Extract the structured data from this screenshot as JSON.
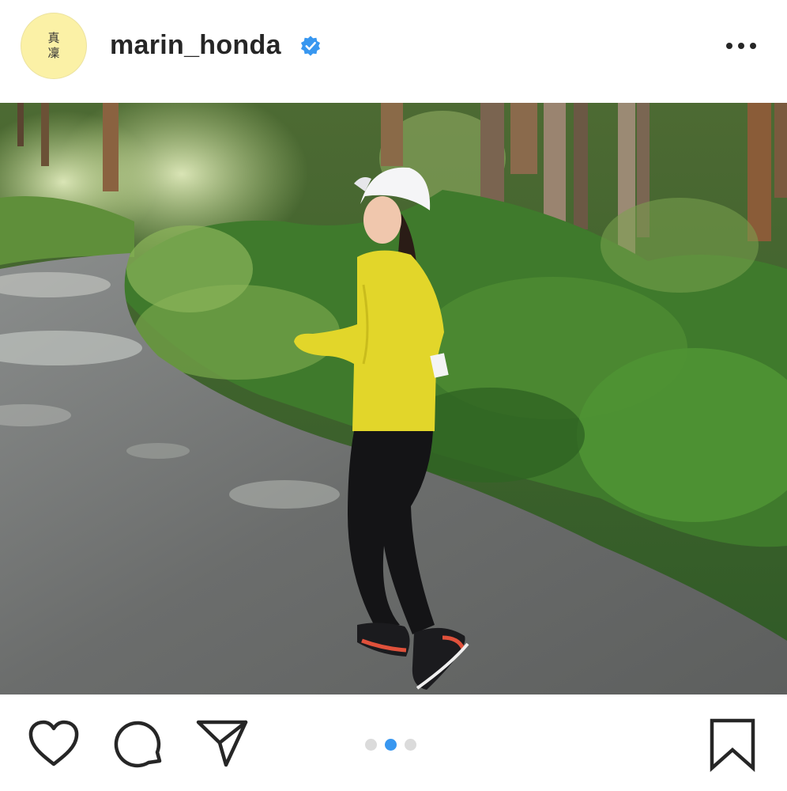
{
  "post": {
    "username": "marin_honda",
    "avatar_text": [
      "真",
      "凜"
    ],
    "verified": true,
    "more_icon": "more-horizontal-icon"
  },
  "carousel": {
    "count": 3,
    "active_index": 1
  },
  "actions": {
    "icons": [
      "heart-icon",
      "comment-icon",
      "share-icon",
      "bookmark-icon"
    ]
  },
  "colors": {
    "verified_blue": "#3897f0",
    "active_dot": "#3897f0",
    "inactive_dot": "#dbdbdb",
    "text": "#262626"
  }
}
